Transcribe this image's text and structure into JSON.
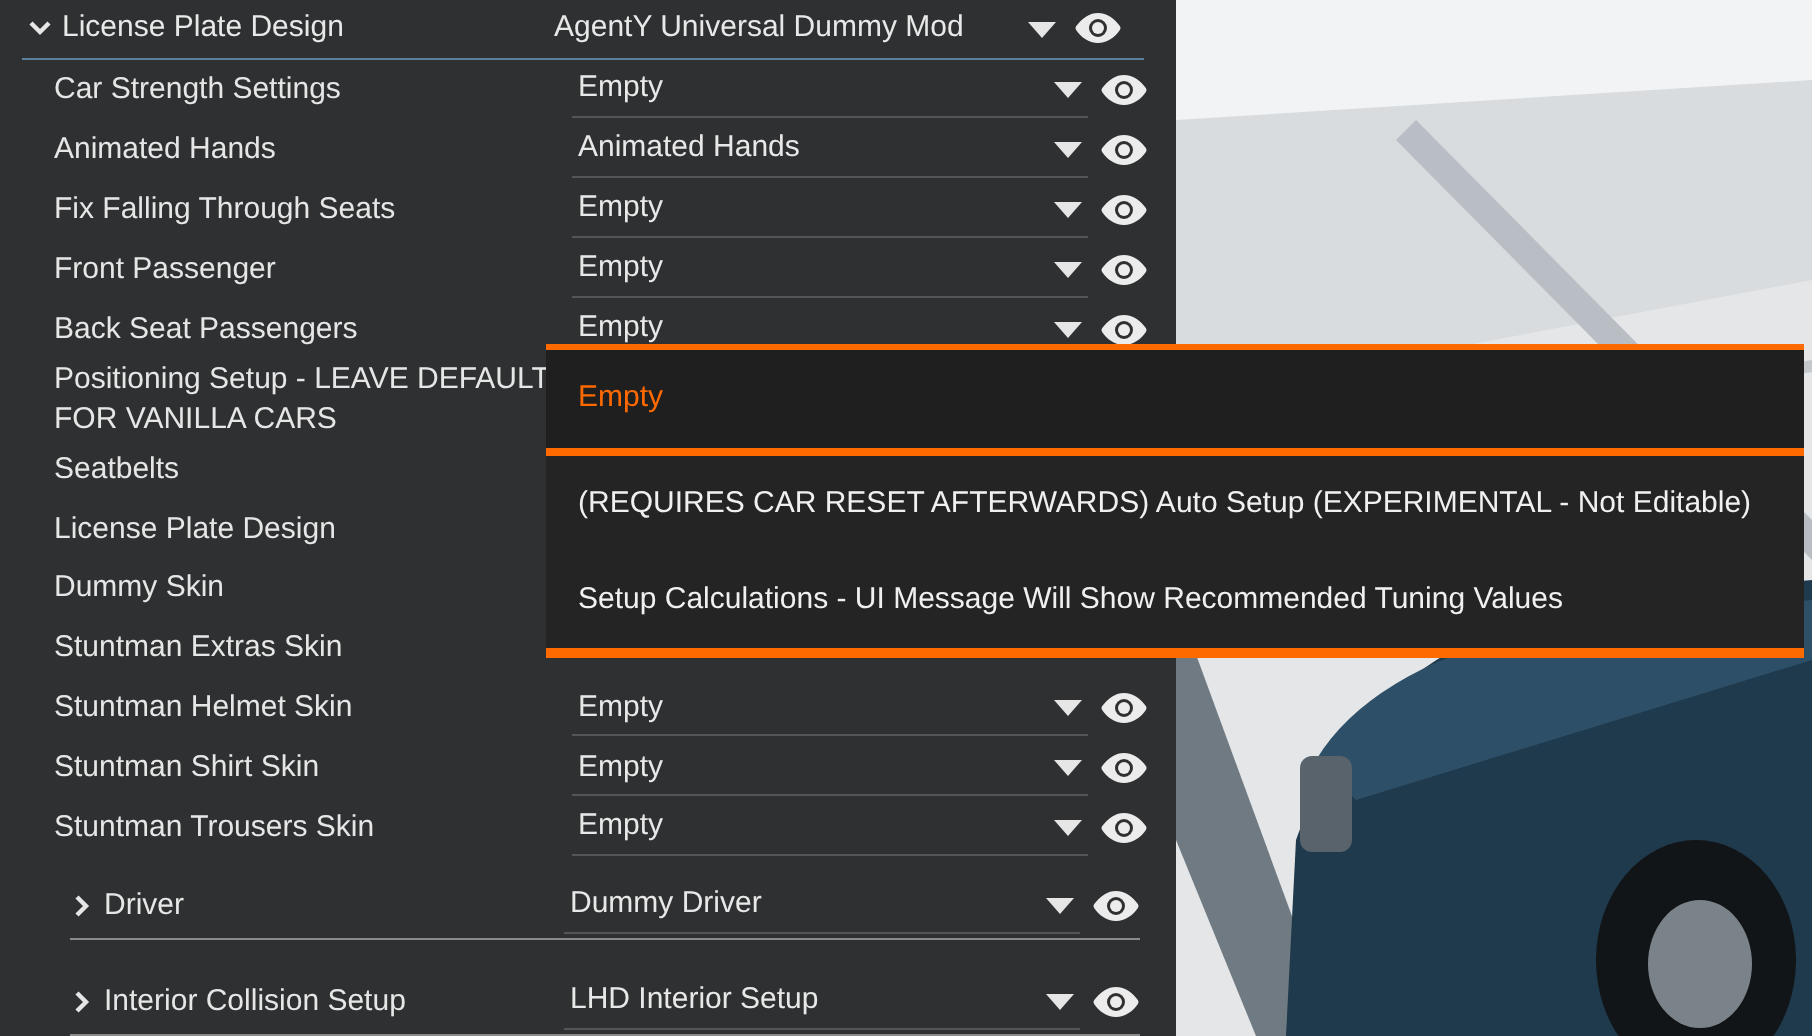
{
  "header": {
    "label": "License Plate Design",
    "value": "AgentY Universal Dummy Mod",
    "expanded": true
  },
  "slots": [
    {
      "label": "Car Strength Settings",
      "value": "Empty"
    },
    {
      "label": "Animated Hands",
      "value": "Animated Hands"
    },
    {
      "label": "Fix Falling Through Seats",
      "value": "Empty"
    },
    {
      "label": "Front Passenger",
      "value": "Empty"
    },
    {
      "label": "Back Seat Passengers",
      "value": "Empty"
    },
    {
      "label": "Positioning Setup - LEAVE DEFAULT FOR VANILLA CARS"
    },
    {
      "label": "Seatbelts"
    },
    {
      "label": "License Plate Design"
    },
    {
      "label": "Dummy Skin"
    },
    {
      "label": "Stuntman Extras Skin"
    },
    {
      "label": "Stuntman Helmet Skin",
      "value": "Empty"
    },
    {
      "label": "Stuntman Shirt Skin",
      "value": "Empty"
    },
    {
      "label": "Stuntman Trousers Skin",
      "value": "Empty"
    }
  ],
  "groups": [
    {
      "label": "Driver",
      "value": "Dummy Driver",
      "expanded": false
    },
    {
      "label": "Interior Collision Setup",
      "value": "LHD Interior Setup",
      "expanded": false
    }
  ],
  "dropdown": {
    "options": [
      {
        "label": "Empty",
        "selected": true
      },
      {
        "label": "(REQUIRES CAR RESET AFTERWARDS) Auto Setup (EXPERIMENTAL - Not Editable)",
        "selected": false
      },
      {
        "label": "Setup Calculations - UI Message Will Show Recommended Tuning Values",
        "selected": false
      }
    ]
  }
}
